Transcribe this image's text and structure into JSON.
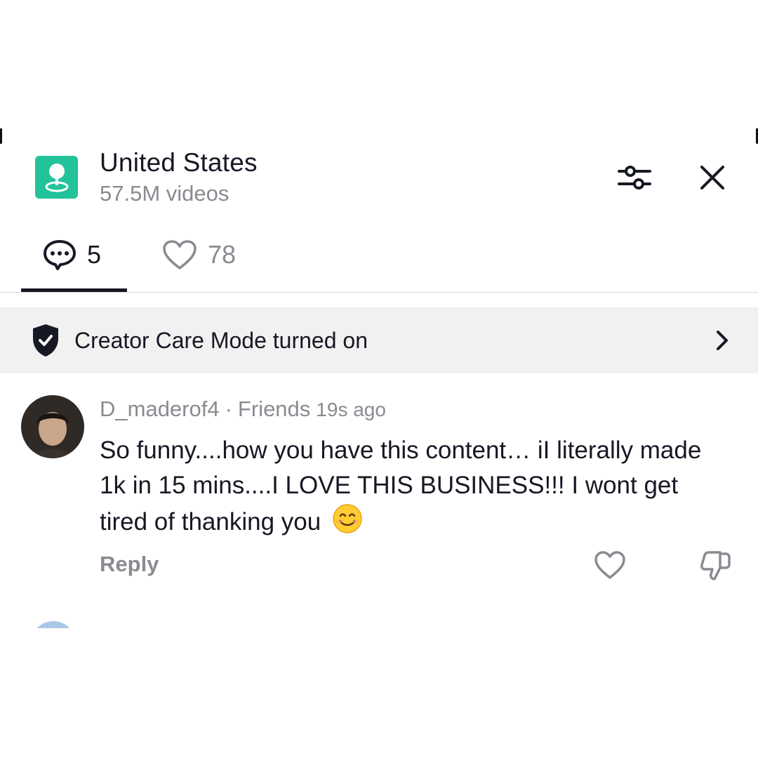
{
  "header": {
    "title": "United States",
    "subtitle": "57.5M videos",
    "location_icon": "location-pin-icon",
    "filter_icon": "sliders-icon",
    "close_icon": "close-icon"
  },
  "tabs": [
    {
      "name": "comments",
      "icon": "comment-bubble-icon",
      "count": "5",
      "selected": true
    },
    {
      "name": "likes",
      "icon": "heart-outline-icon",
      "count": "78",
      "selected": false
    }
  ],
  "banner": {
    "icon": "shield-check-icon",
    "text": "Creator Care Mode turned on",
    "chevron": "chevron-right-icon"
  },
  "comment": {
    "username": "D_maderof4",
    "separator": "·",
    "relation": "Friends",
    "time": "19s ago",
    "text": "So funny....how you have this content… iI literally made 1k in 15 mins....I LOVE THIS BUSINESS!!! I wont get tired of thanking you",
    "emoji": "smiling-face-icon",
    "reply_label": "Reply",
    "like_icon": "heart-outline-icon",
    "dislike_icon": "thumbs-down-icon"
  },
  "colors": {
    "brand_green": "#22c29a",
    "text_primary": "#161823",
    "text_secondary": "#8a8b91",
    "banner_bg": "#f1f1f2"
  }
}
